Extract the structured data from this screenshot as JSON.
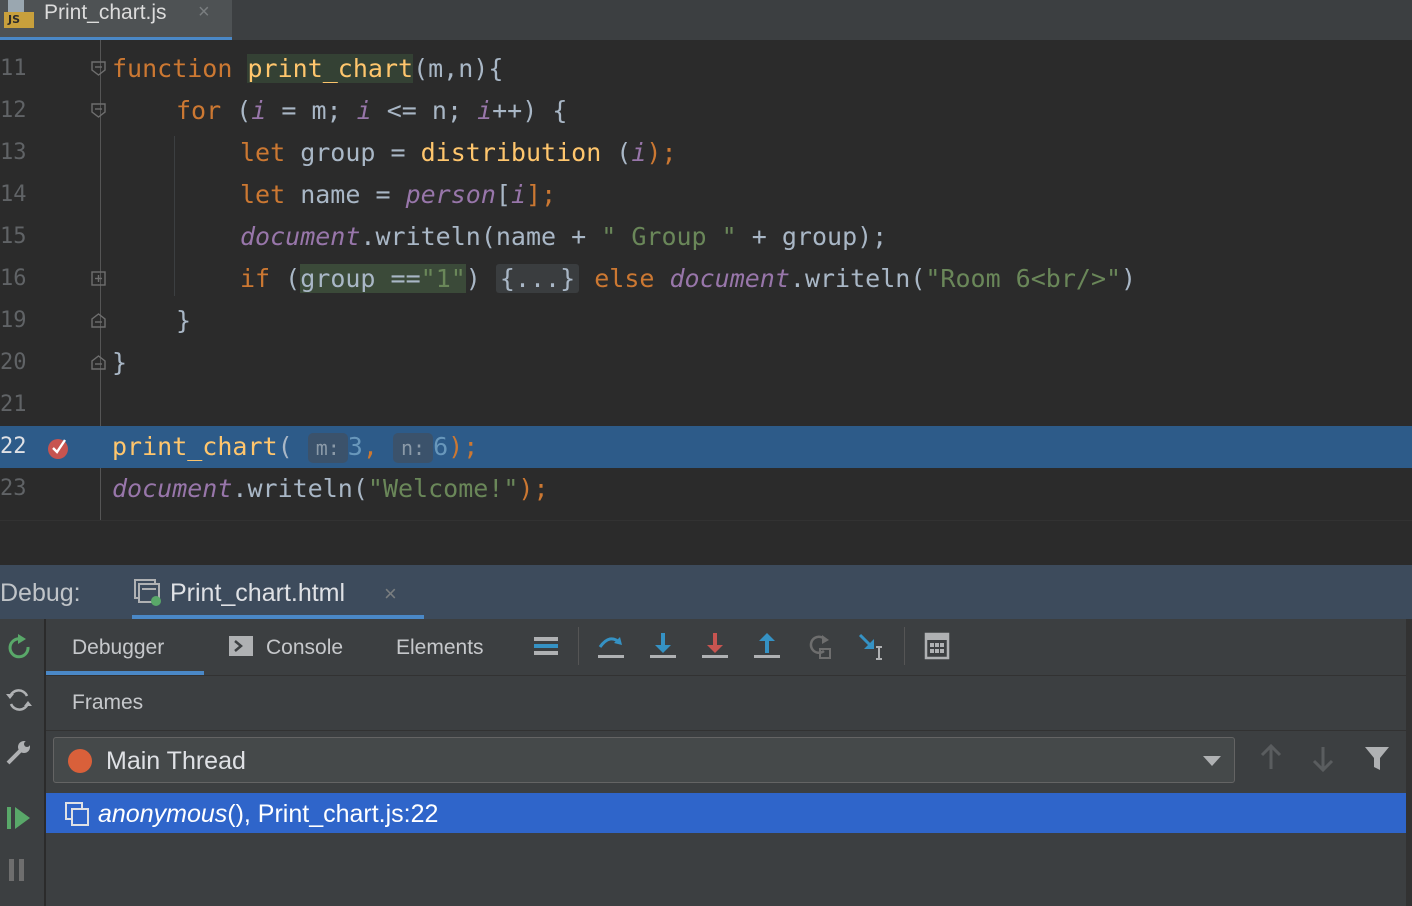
{
  "editor_tab": {
    "label": "Print_chart.js",
    "close": "×",
    "badge": "JS"
  },
  "line_numbers": [
    "11",
    "12",
    "13",
    "14",
    "15",
    "16",
    "19",
    "20",
    "21",
    "22",
    "23"
  ],
  "code": {
    "l11": {
      "kw": "function",
      "fn": "print_chart",
      "rest": "(m,n){"
    },
    "l12": {
      "kw": "for",
      "a": " (",
      "v1": "i",
      "b": " = m; ",
      "v2": "i",
      "c": " <= n; ",
      "v3": "i",
      "d": "++) {"
    },
    "l13": {
      "kw": "let",
      "a": " group = ",
      "fn": "distribution",
      "b": " (",
      "v": "i",
      "c": ");"
    },
    "l14": {
      "kw": "let",
      "a": " name = ",
      "glob": "person",
      "b": "[",
      "v": "i",
      "c": "];"
    },
    "l15": {
      "glob": "document",
      "a": ".writeln(name + ",
      "str": "\" Group \"",
      "b": " + group);"
    },
    "l16": {
      "kw": "if",
      "a": " (",
      "hl": "group ==",
      "str": "\"1\"",
      "b": ") ",
      "fold": "{...}",
      "kw2": " else ",
      "glob": "document",
      "c": ".writeln(",
      "str2": "\"Room 6<br/>\"",
      "d": ")"
    },
    "l19": {
      "text": "}"
    },
    "l20": {
      "text": "}"
    },
    "l22": {
      "fn": "print_chart",
      "a": "(",
      "hint_m": "m:",
      "m": "3",
      "comma": ",",
      "hint_n": "n:",
      "n": "6",
      "b": ");"
    },
    "l23": {
      "glob": "document",
      "a": ".writeln(",
      "str": "\"Welcome!\"",
      "b": ");"
    }
  },
  "debug": {
    "title": "Debug:",
    "session_tab": "Print_chart.html",
    "session_close": "×",
    "tabs": [
      "Debugger",
      "Console",
      "Elements"
    ],
    "frames_label": "Frames",
    "thread": "Main Thread",
    "frame_fn": "anonymous",
    "frame_rest": "(), Print_chart.js:22"
  },
  "colors": {
    "accent": "#4a88c7",
    "current_line": "#2d5b89",
    "selected_frame": "#2f65ca",
    "breakpoint": "#c75450",
    "thread_dot": "#d9603a"
  }
}
